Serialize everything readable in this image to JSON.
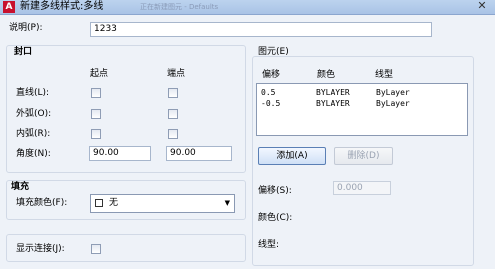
{
  "window": {
    "title": "新建多线样式:多线",
    "ghost_text": "正在新建图元 - Defaults"
  },
  "description": {
    "label": "说明(P):",
    "value": "1233"
  },
  "caps": {
    "group_title": "封口",
    "col_start": "起点",
    "col_end": "端点",
    "rows": [
      {
        "label": "直线(L):"
      },
      {
        "label": "外弧(O):"
      },
      {
        "label": "内弧(R):"
      },
      {
        "label": "角度(N):",
        "start_value": "90.00",
        "end_value": "90.00"
      }
    ]
  },
  "fill": {
    "group_title": "填充",
    "label": "填充颜色(F):",
    "value": "无"
  },
  "display_joints": {
    "label": "显示连接(J):"
  },
  "elements": {
    "group_title": "图元(E)",
    "headers": [
      "偏移",
      "颜色",
      "线型"
    ],
    "rows": [
      {
        "offset": "0.5",
        "color": "BYLAYER",
        "linetype": "ByLayer"
      },
      {
        "offset": "-0.5",
        "color": "BYLAYER",
        "linetype": "ByLayer"
      }
    ],
    "add_label": "添加(A)",
    "delete_label": "删除(D)",
    "offset_label": "偏移(S):",
    "offset_value": "0.000",
    "color_label": "颜色(C):",
    "linetype_label": "线型:"
  }
}
